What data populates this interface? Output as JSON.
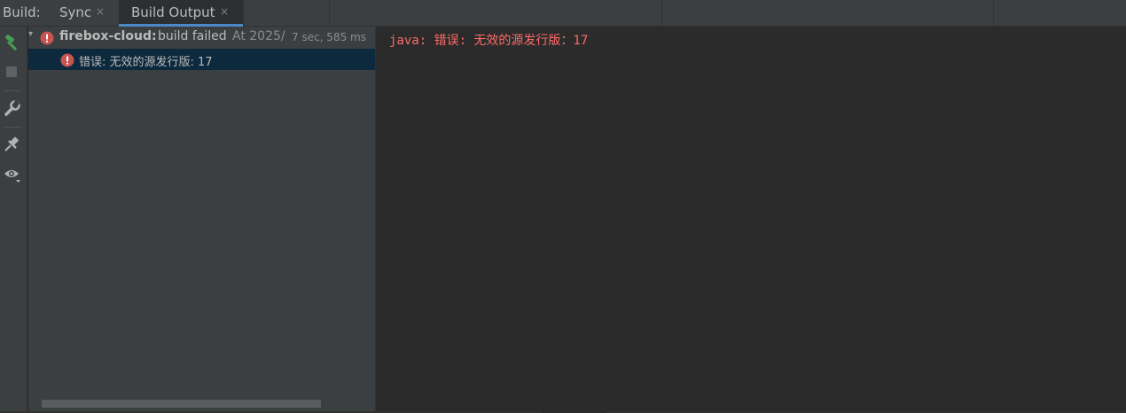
{
  "window": {
    "build_label": "Build:",
    "tabs": [
      {
        "label": "Sync",
        "close": "×",
        "selected": false
      },
      {
        "label": "Build Output",
        "close": "×",
        "selected": true
      }
    ]
  },
  "toolbar": {
    "tools": [
      {
        "icon": "hammer-icon",
        "color": "#499c54"
      },
      {
        "icon": "stop-icon",
        "color": "#5f6264"
      },
      {
        "icon": "wrench-icon",
        "color": "#afb1b3"
      },
      {
        "icon": "pin-icon",
        "color": "#afb1b3"
      },
      {
        "icon": "eye-icon",
        "color": "#afb1b3"
      }
    ]
  },
  "tree": {
    "root": {
      "expand_glyph": "▾",
      "status_icon": "error-icon",
      "project": "firebox-cloud:",
      "status": "build failed",
      "date": "At 2025/",
      "duration": "7 sec, 585 ms"
    },
    "children": [
      {
        "status_icon": "error-icon",
        "message": "错误: 无效的源发行版: 17"
      }
    ]
  },
  "console": {
    "lines": [
      "java: 错误: 无效的源发行版：17"
    ]
  },
  "colors": {
    "error": "#ff6b68",
    "selection": "#0d293e",
    "accent": "#4a88c7",
    "hammer": "#499c54"
  }
}
